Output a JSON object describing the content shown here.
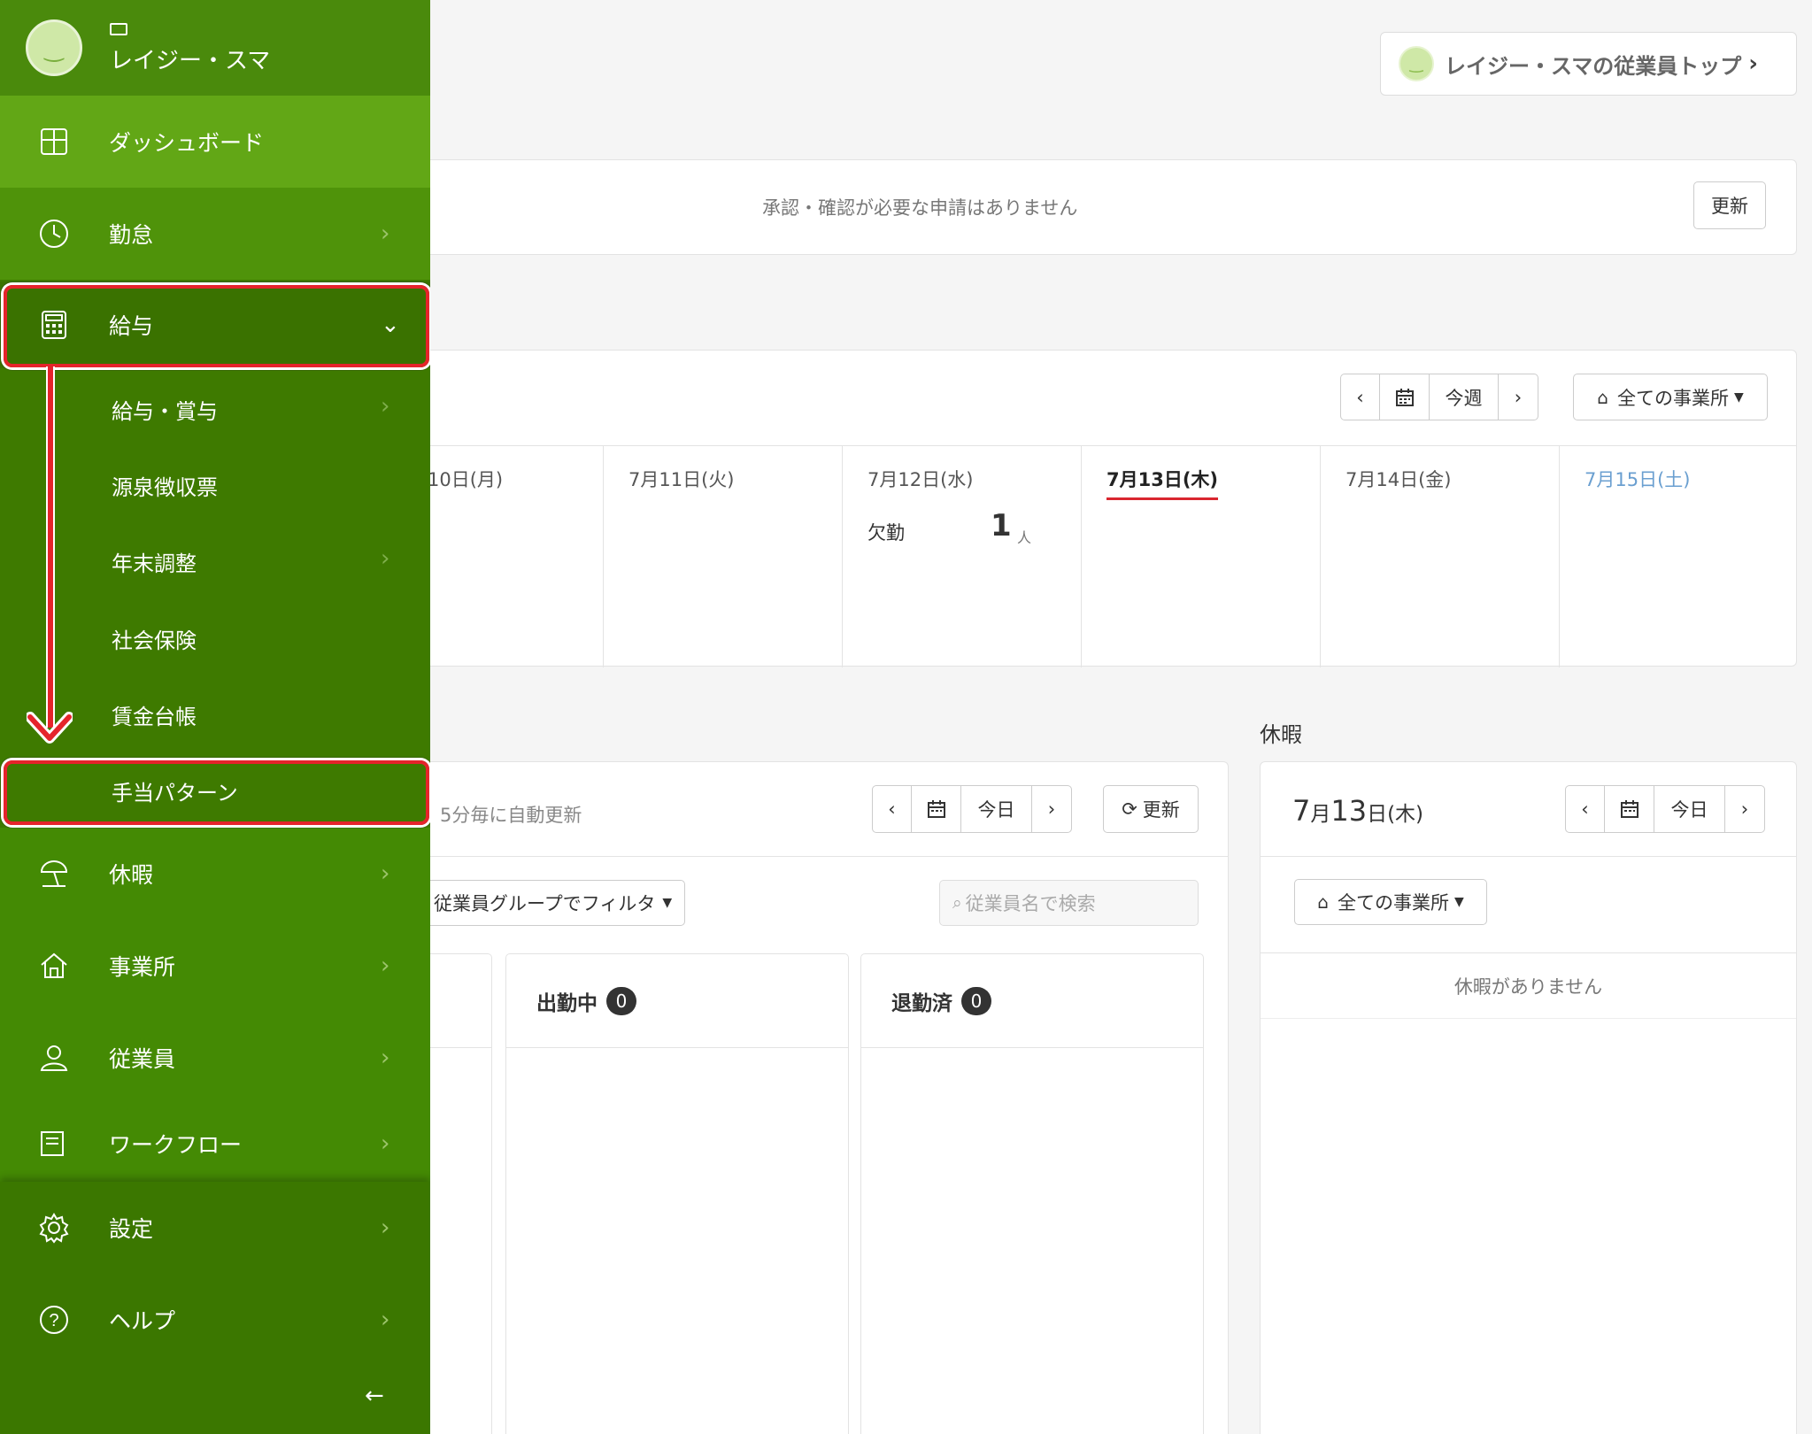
{
  "header": {
    "employee_top_label": "レイジー・スマの従業員トップ"
  },
  "approval": {
    "message": "承認・確認が必要な申請はありません",
    "refresh_label": "更新"
  },
  "weekly": {
    "today_label": "今週",
    "office_filter": "全ての事業所",
    "days": [
      {
        "label": "10日(月)"
      },
      {
        "label": "7月11日(火)"
      },
      {
        "label": "7月12日(水)",
        "absence_label": "欠勤",
        "absence_count": "1",
        "absence_unit": "人"
      },
      {
        "label": "7月13日(木)"
      },
      {
        "label": "7月14日(金)"
      },
      {
        "label": "7月15日(土)"
      }
    ]
  },
  "attendance": {
    "auto_refresh_text": "5分毎に自動更新",
    "today_label": "今日",
    "refresh_label": "更新",
    "group_filter": "従業員グループでフィルタ",
    "search_placeholder": "従業員名で検索",
    "columns": [
      {
        "title": "出勤中",
        "count": "0"
      },
      {
        "title": "退勤済",
        "count": "0"
      }
    ]
  },
  "leave": {
    "heading": "休暇",
    "date_day": "7",
    "date_month_suffix": "月",
    "date_num": "13",
    "date_day_suffix": "日(木)",
    "today_label": "今日",
    "office_filter": "全ての事業所",
    "empty_message": "休暇がありません"
  },
  "sidebar": {
    "username": "レイジー・スマ",
    "items": {
      "dashboard": "ダッシュボード",
      "kintai": "勤怠",
      "kyuyo": "給与",
      "leave": "休暇",
      "office": "事業所",
      "employee": "従業員",
      "workflow": "ワークフロー",
      "settings": "設定",
      "help": "ヘルプ"
    },
    "kyuyo_sub": [
      "給与・賞与",
      "源泉徴収票",
      "年末調整",
      "社会保険",
      "賃金台帳",
      "手当パターン"
    ]
  },
  "colors": {
    "sidebar": "#3e7a00",
    "active": "#62a716",
    "highlight": "#e5242b",
    "saturday": "#6a9fd0"
  }
}
